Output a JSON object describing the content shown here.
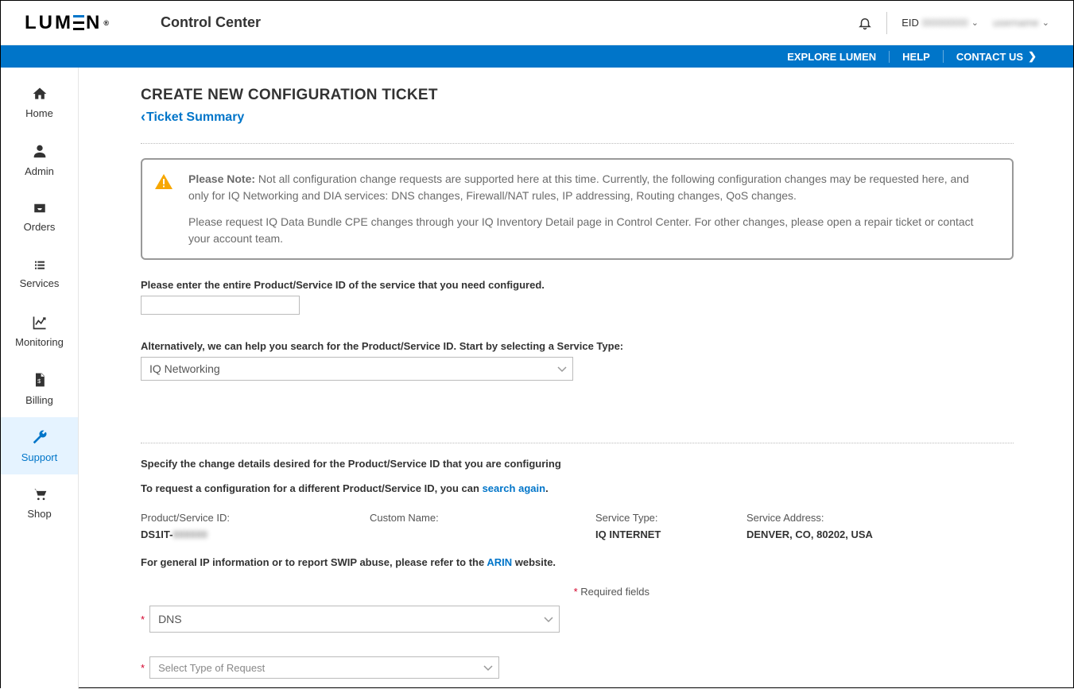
{
  "header": {
    "app_title": "Control Center",
    "eid_label": "EID",
    "eid_value": "00000000",
    "username": "username"
  },
  "bluebar": {
    "explore": "EXPLORE LUMEN",
    "help": "HELP",
    "contact": "CONTACT US"
  },
  "sidebar": {
    "items": [
      {
        "label": "Home"
      },
      {
        "label": "Admin"
      },
      {
        "label": "Orders"
      },
      {
        "label": "Services"
      },
      {
        "label": "Monitoring"
      },
      {
        "label": "Billing"
      },
      {
        "label": "Support"
      },
      {
        "label": "Shop"
      }
    ]
  },
  "page": {
    "title": "CREATE NEW CONFIGURATION TICKET",
    "back_label": "Ticket Summary",
    "note_strong": "Please Note:",
    "note_p1": " Not all configuration change requests are supported here at this time. Currently, the following configuration changes may be requested here, and only for IQ Networking and DIA services: DNS changes, Firewall/NAT rules, IP addressing, Routing changes, QoS changes.",
    "note_p2": "Please request IQ Data Bundle CPE changes through your IQ Inventory Detail page in Control Center. For other changes, please open a repair ticket or contact your account team.",
    "product_id_label": "Please enter the entire Product/Service ID of the service that you need configured.",
    "alt_label": "Alternatively, we can help you search for the Product/Service ID. Start by selecting a Service Type:",
    "service_type_value": "IQ Networking",
    "specify_label": "Specify the change details desired for the Product/Service ID that you are configuring",
    "search_again_prefix": "To request a configuration for a different Product/Service ID, you can ",
    "search_again_link": "search again",
    "search_again_suffix": ".",
    "details": {
      "psid_label": "Product/Service ID:",
      "psid_value_prefix": "DS1IT-",
      "psid_value_blur": "000000",
      "custom_name_label": "Custom Name:",
      "custom_name_value": "",
      "service_type_label": "Service Type:",
      "service_type_value": "IQ INTERNET",
      "service_addr_label": "Service Address:",
      "service_addr_value": "DENVER, CO, 80202, USA"
    },
    "arin_prefix": "For general IP information or to report SWIP abuse, please refer to the ",
    "arin_link": "ARIN",
    "arin_suffix": " website.",
    "required_fields": " Required fields",
    "dns_value": "DNS",
    "req_type_placeholder": "Select Type of Request"
  }
}
